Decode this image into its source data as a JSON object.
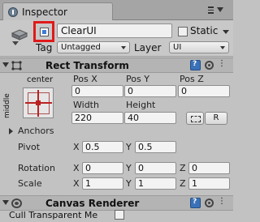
{
  "tab": {
    "title": "Inspector"
  },
  "header": {
    "name": "ClearUI",
    "static_label": "Static",
    "tag_label": "Tag",
    "tag_value": "Untagged",
    "layer_label": "Layer",
    "layer_value": "UI"
  },
  "rect_transform": {
    "title": "Rect Transform",
    "anchor_h": "center",
    "anchor_v": "middle",
    "pos_x_label": "Pos X",
    "pos_y_label": "Pos Y",
    "pos_z_label": "Pos Z",
    "pos_x": "0",
    "pos_y": "0",
    "pos_z": "0",
    "width_label": "Width",
    "height_label": "Height",
    "width": "220",
    "height": "40",
    "raw_label": "R",
    "anchors_label": "Anchors",
    "pivot_label": "Pivot",
    "pivot_x": "0.5",
    "pivot_y": "0.5",
    "rotation_label": "Rotation",
    "rot_x": "0",
    "rot_y": "0",
    "rot_z": "0",
    "scale_label": "Scale",
    "scale_x": "1",
    "scale_y": "1",
    "scale_z": "1",
    "axis_x": "X",
    "axis_y": "Y",
    "axis_z": "Z"
  },
  "canvas_renderer": {
    "title": "Canvas Renderer",
    "cull_label": "Cull Transparent Me"
  },
  "colors": {
    "highlight": "#e01a1a",
    "panel": "#c2c2c2"
  }
}
